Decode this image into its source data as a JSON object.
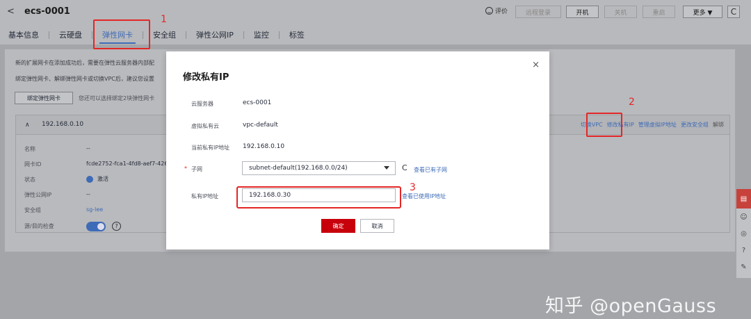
{
  "header": {
    "back_glyph": "<",
    "title": "ecs-0001",
    "rate_label": "评价",
    "buttons": [
      "远程登录",
      "开机",
      "关机",
      "重启",
      "更多 ▼"
    ],
    "refresh_glyph": "C"
  },
  "tabs": [
    "基本信息",
    "云硬盘",
    "弹性网卡",
    "安全组",
    "弹性公网IP",
    "监控",
    "标签"
  ],
  "annotations": [
    "1",
    "2",
    "3"
  ],
  "content": {
    "note1": "新的扩展网卡在添加成功后，需要在弹性云服务器内部配",
    "note2": "绑定弹性网卡、解绑弹性网卡或切换VPC后，建议您设置",
    "bind_button": "绑定弹性网卡",
    "bind_tip": "您还可以选择绑定2块弹性网卡",
    "panel": {
      "chevron": "∧",
      "ip": "192.168.0.10",
      "links": [
        "切换VPC",
        "修改私有IP",
        "管理虚拟IP地址",
        "更改安全组",
        "解绑"
      ],
      "rows": [
        {
          "label": "名称",
          "value": "--"
        },
        {
          "label": "网卡ID",
          "value": "fcde2752-fca1-4fd8-aef7-426"
        },
        {
          "label": "状态",
          "value": "激活"
        },
        {
          "label": "弹性公网IP",
          "value": "--"
        },
        {
          "label": "安全组",
          "value": "sg-lee"
        },
        {
          "label": "源/目的检查",
          "value": ""
        }
      ],
      "help_glyph": "?"
    }
  },
  "modal": {
    "title": "修改私有IP",
    "close_glyph": "×",
    "fields": [
      {
        "label": "云服务器",
        "value": "ecs-0001"
      },
      {
        "label": "虚拟私有云",
        "value": "vpc-default"
      },
      {
        "label": "当前私有IP地址",
        "value": "192.168.0.10"
      }
    ],
    "subnet": {
      "required_mark": "*",
      "label": "子网",
      "value": "subnet-default(192.168.0.0/24)",
      "refresh_glyph": "C",
      "link": "查看已有子网"
    },
    "ip": {
      "label": "私有IP地址",
      "value": "192.168.0.30",
      "link": "查看已使用IP地址"
    },
    "ok": "确定",
    "cancel": "取消"
  },
  "rightbar": [
    "chat-icon",
    "smile-icon",
    "eye-icon",
    "help-icon",
    "edit-icon"
  ],
  "watermark": "知乎 @openGauss"
}
